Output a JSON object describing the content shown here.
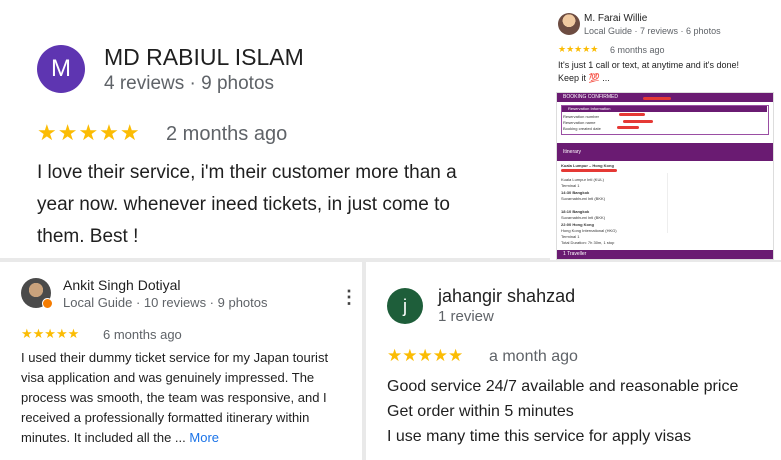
{
  "review1": {
    "avatar_letter": "M",
    "avatar_color": "#5e35b1",
    "name": "MD RABIUL ISLAM",
    "meta": "4 reviews · 9 photos",
    "stars": "★★★★★",
    "when": "2 months ago",
    "lines": [
      "I love their service, i'm their customer more than a",
      "year now. whenever ineed tickets, in just come to",
      "them. Best !"
    ]
  },
  "review2": {
    "name": "M. Farai Willie",
    "meta": "Local Guide · 7 reviews · 6 photos",
    "stars": "★★★★★",
    "when": "6 months ago",
    "lines": [
      "It's just 1 call or text, at anytime and it's done!",
      "Keep it 💯 ..."
    ],
    "doc": {
      "header": "BOOKING CONFIRMED",
      "section_reservation": "Reservation Information",
      "res_rows": [
        "Reservation number",
        "Reservation name",
        "Booking created date"
      ],
      "section_itinerary": "Itinerary",
      "route": "Kuala Lumpur – Hong Kong",
      "leg_lines": [
        "Kuala Lumpur Intl (KUL)",
        "Terminal 1",
        "14:30 Bangkok",
        "Suvarnabhumi Intl (BKK)",
        "18:10 Bangkok",
        "Suvarnabhumi Intl (BKK)",
        "22:00 Hong Kong",
        "Hong Kong International (HKG)",
        "Terminal 1",
        "Total Duration: 7h 30m, 1 stop"
      ],
      "traveller": "1 Traveller"
    }
  },
  "review3": {
    "name": "Ankit Singh Dotiyal",
    "meta": "Local Guide · 10 reviews · 9 photos",
    "stars": "★★★★★",
    "when": "6 months ago",
    "lines": [
      "I used their dummy ticket service for my Japan tourist",
      "visa application and was genuinely impressed. The",
      "process was smooth, the team was responsive, and I",
      "received a professionally formatted itinerary within",
      "minutes. It included all the ..."
    ],
    "more": "More"
  },
  "review4": {
    "avatar_letter": "j",
    "avatar_color": "#1e5e3a",
    "name": "jahangir shahzad",
    "meta": "1 review",
    "stars": "★★★★★",
    "when": "a month ago",
    "lines": [
      "Good service 24/7 available and reasonable price",
      "Get order within 5 minutes",
      "I use many time this service for apply visas"
    ]
  }
}
